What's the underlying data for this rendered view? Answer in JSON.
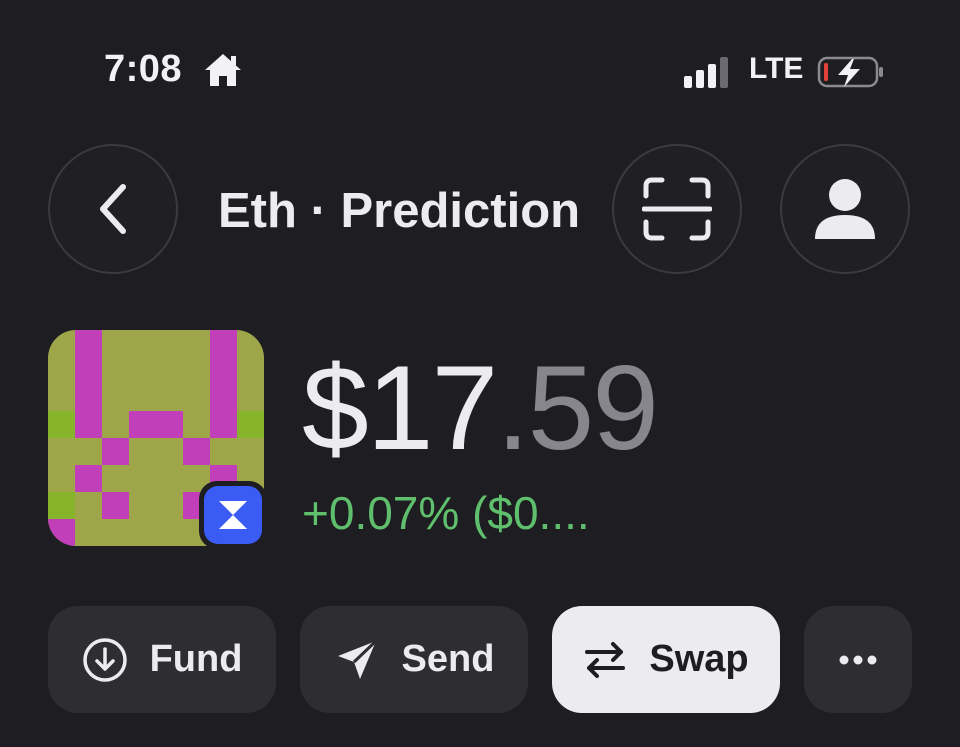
{
  "status_bar": {
    "time": "7:08",
    "network": "LTE",
    "icons": [
      "home-icon",
      "signal-bars-icon",
      "battery-charging-icon"
    ]
  },
  "header": {
    "title": "Eth · Prediction",
    "icons": [
      "chevron-left-icon",
      "scan-icon",
      "person-icon"
    ]
  },
  "token": {
    "balance_main": "$17",
    "balance_cents": ".59",
    "change": "+0.07% ($0....",
    "avatar_icon": "pixel-art-token-avatar",
    "chain_badge_icon": "zora-chain-icon"
  },
  "actions": {
    "fund_label": "Fund",
    "send_label": "Send",
    "swap_label": "Swap",
    "icons": [
      "arrow-down-circle-icon",
      "send-arrow-icon",
      "swap-arrows-icon",
      "more-dots-icon"
    ]
  },
  "colors": {
    "background": "#1e1e22",
    "button_bg": "#2d2d32",
    "swap_button_bg": "#ececee",
    "positive": "#5fbf6d",
    "cents_gray": "#86868c",
    "chain_badge": "#3a5cf5",
    "avatar_olive": "#9fa64a",
    "avatar_magenta": "#c13fb8",
    "avatar_green": "#86b52c"
  }
}
